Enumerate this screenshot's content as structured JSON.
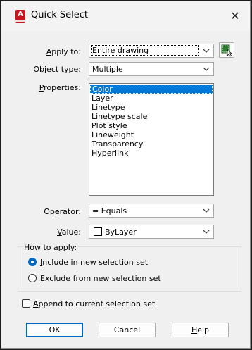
{
  "window": {
    "title": "Quick Select",
    "close_glyph": "✕",
    "app_icon_letter": "A"
  },
  "apply_to": {
    "label_pre": "",
    "label_key": "A",
    "label_post": "pply to:",
    "value": "Entire drawing"
  },
  "object_type": {
    "label_pre": "",
    "label_key": "O",
    "label_post": "bject type:",
    "value": "Multiple"
  },
  "properties": {
    "label_pre": "",
    "label_key": "P",
    "label_post": "roperties:",
    "items": [
      "Color",
      "Layer",
      "Linetype",
      "Linetype scale",
      "Plot style",
      "Lineweight",
      "Transparency",
      "Hyperlink"
    ],
    "selected": "Color"
  },
  "operator": {
    "label_pre": "Op",
    "label_key": "e",
    "label_post": "rator:",
    "value": "= Equals"
  },
  "value": {
    "label_pre": "",
    "label_key": "V",
    "label_post": "alue:",
    "value": "ByLayer",
    "swatch_color": "#ffffff"
  },
  "how_to_apply": {
    "title": "How to apply:",
    "include": {
      "pre": "",
      "key": "I",
      "post": "nclude in new selection set",
      "checked": true
    },
    "exclude": {
      "pre": "",
      "key": "E",
      "post": "xclude from new selection set",
      "checked": false
    }
  },
  "append": {
    "pre": "",
    "key": "A",
    "post": "ppend to current selection set",
    "checked": false
  },
  "buttons": {
    "ok": "OK",
    "cancel": "Cancel",
    "help_key": "H",
    "help_post": "elp"
  },
  "colors": {
    "accent": "#0078d7",
    "default_border": "#0067c0",
    "app_icon": "#c4161c"
  },
  "icons": {
    "select_objects": "select-objects-icon",
    "dropdown": "chevron-down-icon"
  }
}
